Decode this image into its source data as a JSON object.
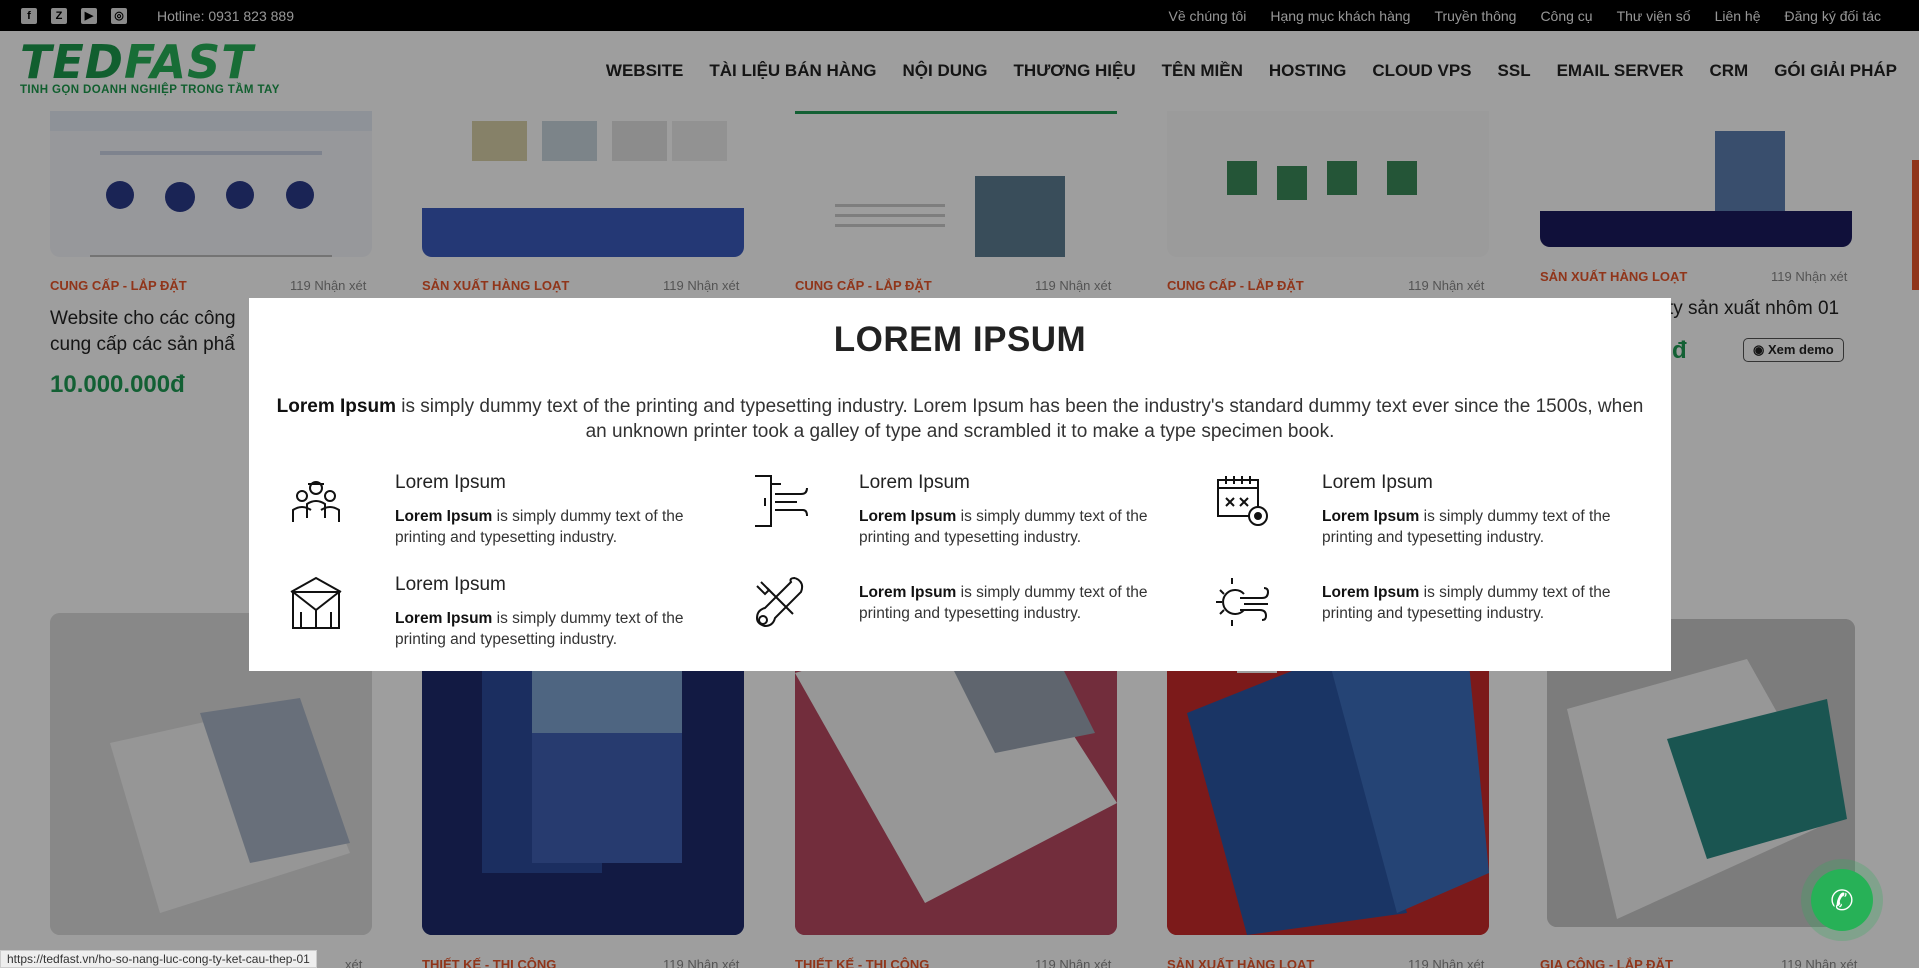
{
  "topbar": {
    "social": [
      {
        "icon": "facebook-icon",
        "glyph": "f"
      },
      {
        "icon": "zalo-icon",
        "glyph": "Z"
      },
      {
        "icon": "youtube-icon",
        "glyph": "▶"
      },
      {
        "icon": "instagram-icon",
        "glyph": "◎"
      }
    ],
    "hotline": "Hotline: 0931 823 889",
    "links": [
      "Về chúng tôi",
      "Hạng mục khách hàng",
      "Truyền thông",
      "Công cụ",
      "Thư viện số",
      "Liên hệ",
      "Đăng ký đối tác"
    ]
  },
  "header": {
    "logo_part1": "TED",
    "logo_part2": "FAST",
    "slogan": "TINH GỌN DOANH NGHIỆP TRONG TẦM TAY",
    "nav": [
      "WEBSITE",
      "TÀI LIỆU BÁN HÀNG",
      "NỘI DUNG",
      "THƯƠNG HIỆU",
      "TÊN MIỀN",
      "HOSTING",
      "CLOUD VPS",
      "SSL",
      "EMAIL SERVER",
      "CRM",
      "GÓI GIẢI PHÁP"
    ]
  },
  "cards_top": [
    {
      "category": "CUNG CẤP - LẮP ĐẶT",
      "reviews": "119 Nhận xét"
    },
    {
      "category": "SẢN XUẤT HÀNG LOẠT",
      "reviews": "119 Nhận xét"
    },
    {
      "category": "CUNG CẤP - LẮP ĐẶT",
      "reviews": "119 Nhận xét"
    },
    {
      "category": "CUNG CẤP - LẮP ĐẶT",
      "reviews": "119 Nhận xét"
    },
    {
      "category": "SẢN XUẤT HÀNG LOẠT",
      "reviews": "119 Nhận xét"
    }
  ],
  "card1_title": "Website cho các công\ncung cấp các sản phẩ",
  "card1_price": "10.000.000đ",
  "card5_title": "ty sản xuất nhôm 01",
  "card5_price": "đ",
  "demo_label": "Xem demo",
  "cards_bottom": [
    {
      "category": "",
      "reviews": "xét"
    },
    {
      "category": "THIẾT KẾ - THI CÔNG",
      "reviews": "119 Nhận xét"
    },
    {
      "category": "THIẾT KẾ - THI CÔNG",
      "reviews": "119 Nhận xét"
    },
    {
      "category": "SẢN XUẤT HÀNG LOẠT",
      "reviews": "119 Nhận xét"
    },
    {
      "category": "GIA CÔNG - LẮP ĐẶT",
      "reviews": "119 Nhận xét"
    }
  ],
  "modal": {
    "title": "LOREM IPSUM",
    "intro_bold": "Lorem Ipsum",
    "intro_text": " is simply dummy text of the printing and typesetting industry. Lorem Ipsum has been the industry's standard dummy text ever since the 1500s, when an unknown printer took a galley of type and scrambled it to make a type specimen book.",
    "features": [
      {
        "icon": "workers-team-icon",
        "title": "Lorem Ipsum",
        "bold": "Lorem Ipsum",
        "text": " is simply dummy text of the printing and typesetting industry."
      },
      {
        "icon": "wall-wind-icon",
        "title": "Lorem Ipsum",
        "bold": "Lorem Ipsum",
        "text": " is simply dummy text of the printing and typesetting industry."
      },
      {
        "icon": "calendar-settings-icon",
        "title": "Lorem Ipsum",
        "bold": "Lorem Ipsum",
        "text": " is simply dummy text of the printing and typesetting industry."
      },
      {
        "icon": "warehouse-icon",
        "title": "Lorem Ipsum",
        "bold": "Lorem Ipsum",
        "text": " is simply dummy text of the printing and typesetting industry."
      },
      {
        "icon": "tools-wrench-icon",
        "title": "",
        "bold": "Lorem Ipsum",
        "text": " is simply dummy text of the printing and typesetting industry."
      },
      {
        "icon": "sun-wind-icon",
        "title": "",
        "bold": "Lorem Ipsum",
        "text": " is simply dummy text of the printing and typesetting industry."
      }
    ]
  },
  "status_url": "https://tedfast.vn/ho-so-nang-luc-cong-ty-ket-cau-thep-01",
  "colors": {
    "brand_green": "#1c9a4c",
    "category_orange": "#e9562a",
    "price_green": "#1f9c55"
  }
}
